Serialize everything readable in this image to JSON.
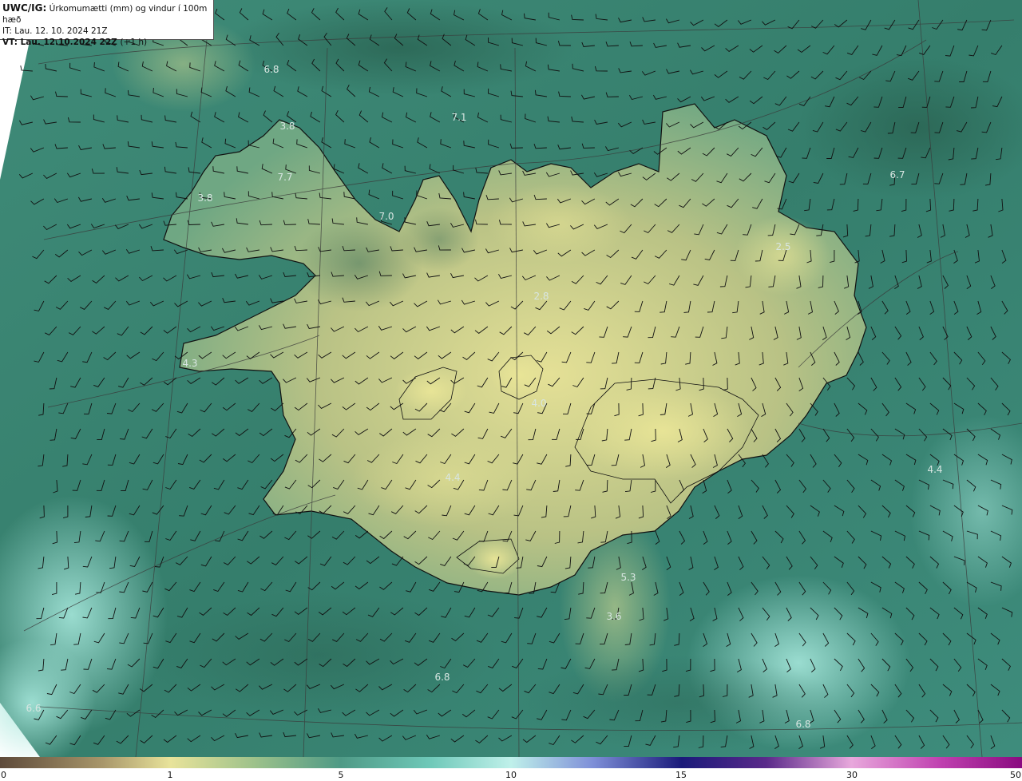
{
  "header": {
    "model": "UWC/IG:",
    "title": "Úrkomumætti (mm) og vindur í 100m hæð",
    "it_line": "IT: Lau. 12. 10. 2024 21Z",
    "vt_line": "VT: Lau. 12.10.2024 22Z",
    "vt_offset": "(+1 h)"
  },
  "colorbar": {
    "ticks": [
      "0",
      "1",
      "5",
      "10",
      "15",
      "30",
      "50"
    ]
  },
  "values": [
    "6.8",
    "3.8",
    "7.1",
    "7.7",
    "3.8",
    "7.0",
    "6.7",
    "2.5",
    "2.8",
    "4.3",
    "4.0",
    "4.4",
    "4.4",
    "5.3",
    "3.6",
    "6.8",
    "6.6",
    "6.8"
  ],
  "colors": {
    "land": "#c9c68a",
    "land_high": "#e3df95",
    "sea": "#3d8a7a",
    "sea_dark": "#2f6e5f",
    "sea_light": "#7ed3c3",
    "coast": "#111111"
  }
}
